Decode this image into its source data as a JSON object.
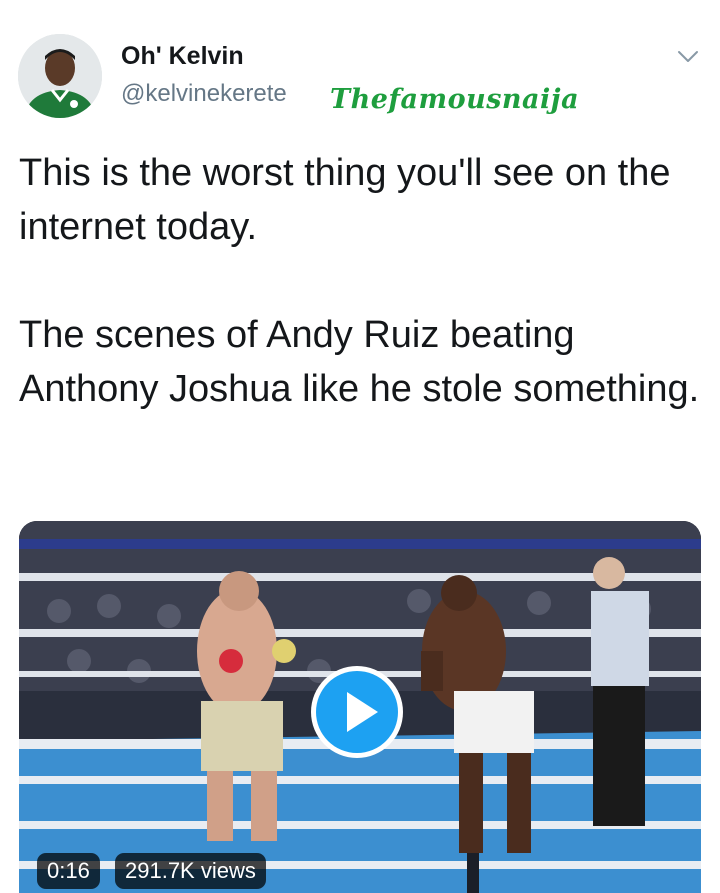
{
  "author": {
    "display_name": "Oh' Kelvin",
    "handle": "@kelvinekerete"
  },
  "watermark": "Thefamousnaija",
  "tweet": {
    "paragraphs": [
      "This is the worst thing you'll see on the internet today.",
      "The scenes of Andy Ruiz beating Anthony Joshua like he stole something."
    ]
  },
  "video": {
    "duration": "0:16",
    "views": "291.7K views"
  },
  "colors": {
    "accent": "#1da1f2",
    "watermark": "#1e9e3e",
    "text": "#14171a",
    "secondary": "#657786"
  },
  "icons": {
    "menu": "chevron-down-icon",
    "play": "play-icon"
  }
}
